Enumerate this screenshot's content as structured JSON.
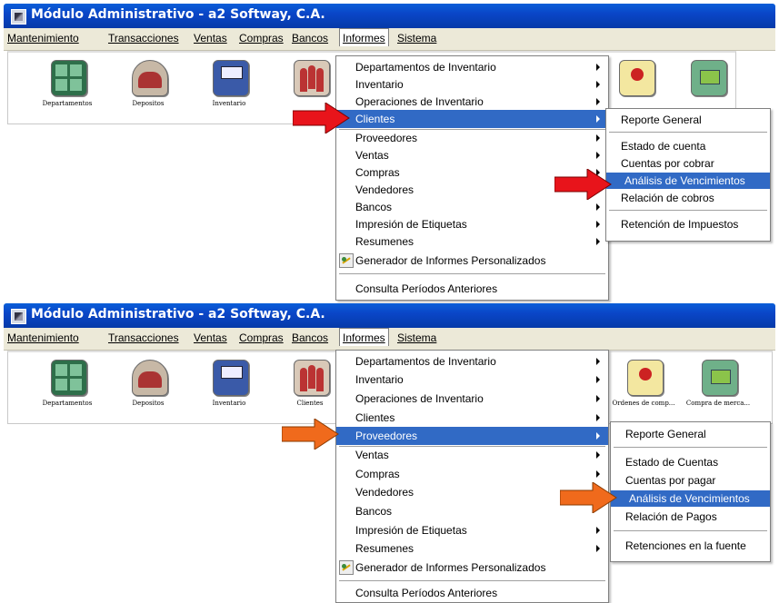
{
  "panel1": {
    "window_title": "Módulo Administrativo - a2 Softway, C.A.",
    "menubar": [
      "Mantenimiento",
      "Transacciones",
      "Ventas",
      "Compras",
      "Bancos",
      "Informes",
      "Sistema"
    ],
    "toolbar": [
      {
        "label": "Departamentos",
        "icon": "departments-icon"
      },
      {
        "label": "Depositos",
        "icon": "warehouse-icon"
      },
      {
        "label": "Inventario",
        "icon": "inventory-icon"
      }
    ],
    "informes_menu": [
      {
        "label": "Departamentos de Inventario",
        "has_submenu": true
      },
      {
        "label": "Inventario",
        "has_submenu": true
      },
      {
        "label": "Operaciones de Inventario",
        "has_submenu": true
      },
      {
        "label": "Clientes",
        "has_submenu": true,
        "highlighted": true
      },
      {
        "label": "Proveedores",
        "has_submenu": true
      },
      {
        "label": "Ventas",
        "has_submenu": true
      },
      {
        "label": "Compras",
        "has_submenu": true
      },
      {
        "label": "Vendedores",
        "has_submenu": false
      },
      {
        "label": "Bancos",
        "has_submenu": true
      },
      {
        "label": "Impresión de Etiquetas",
        "has_submenu": true
      },
      {
        "label": "Resumenes",
        "has_submenu": true
      },
      {
        "label": "Generador de Informes Personalizados",
        "has_submenu": false
      },
      {
        "label": "Consulta Períodos Anteriores",
        "has_submenu": false
      }
    ],
    "submenu": [
      {
        "label": "Reporte General"
      },
      {
        "label": "Estado de cuenta"
      },
      {
        "label": "Cuentas por cobrar"
      },
      {
        "label": "Análisis de Vencimientos",
        "highlighted": true
      },
      {
        "label": "Relación de cobros"
      },
      {
        "label": "Retención de Impuestos"
      }
    ],
    "arrow_color": "#e8141b"
  },
  "panel2": {
    "window_title": "Módulo Administrativo - a2 Softway, C.A.",
    "menubar": [
      "Mantenimiento",
      "Transacciones",
      "Ventas",
      "Compras",
      "Bancos",
      "Informes",
      "Sistema"
    ],
    "toolbar": [
      {
        "label": "Departamentos",
        "icon": "departments-icon"
      },
      {
        "label": "Depositos",
        "icon": "warehouse-icon"
      },
      {
        "label": "Inventario",
        "icon": "inventory-icon"
      },
      {
        "label": "Clientes",
        "icon": "clients-icon"
      },
      {
        "label": "Ordenes de comp...",
        "icon": "purchase-orders-icon"
      },
      {
        "label": "Compra de merca...",
        "icon": "merchandise-purchase-icon"
      }
    ],
    "informes_menu": [
      {
        "label": "Departamentos de Inventario",
        "has_submenu": true
      },
      {
        "label": "Inventario",
        "has_submenu": true
      },
      {
        "label": "Operaciones de Inventario",
        "has_submenu": true
      },
      {
        "label": "Clientes",
        "has_submenu": true
      },
      {
        "label": "Proveedores",
        "has_submenu": true,
        "highlighted": true
      },
      {
        "label": "Ventas",
        "has_submenu": true
      },
      {
        "label": "Compras",
        "has_submenu": true
      },
      {
        "label": "Vendedores",
        "has_submenu": false
      },
      {
        "label": "Bancos",
        "has_submenu": false
      },
      {
        "label": "Impresión de Etiquetas",
        "has_submenu": true
      },
      {
        "label": "Resumenes",
        "has_submenu": true
      },
      {
        "label": "Generador de Informes Personalizados",
        "has_submenu": false
      },
      {
        "label": "Consulta Períodos Anteriores",
        "has_submenu": false
      }
    ],
    "submenu": [
      {
        "label": "Reporte General"
      },
      {
        "label": "Estado de Cuentas"
      },
      {
        "label": "Cuentas por pagar"
      },
      {
        "label": "Análisis de Vencimientos",
        "highlighted": true
      },
      {
        "label": "Relación de Pagos"
      },
      {
        "label": "Retenciones en la fuente"
      }
    ],
    "arrow_color": "#f06a1c"
  }
}
